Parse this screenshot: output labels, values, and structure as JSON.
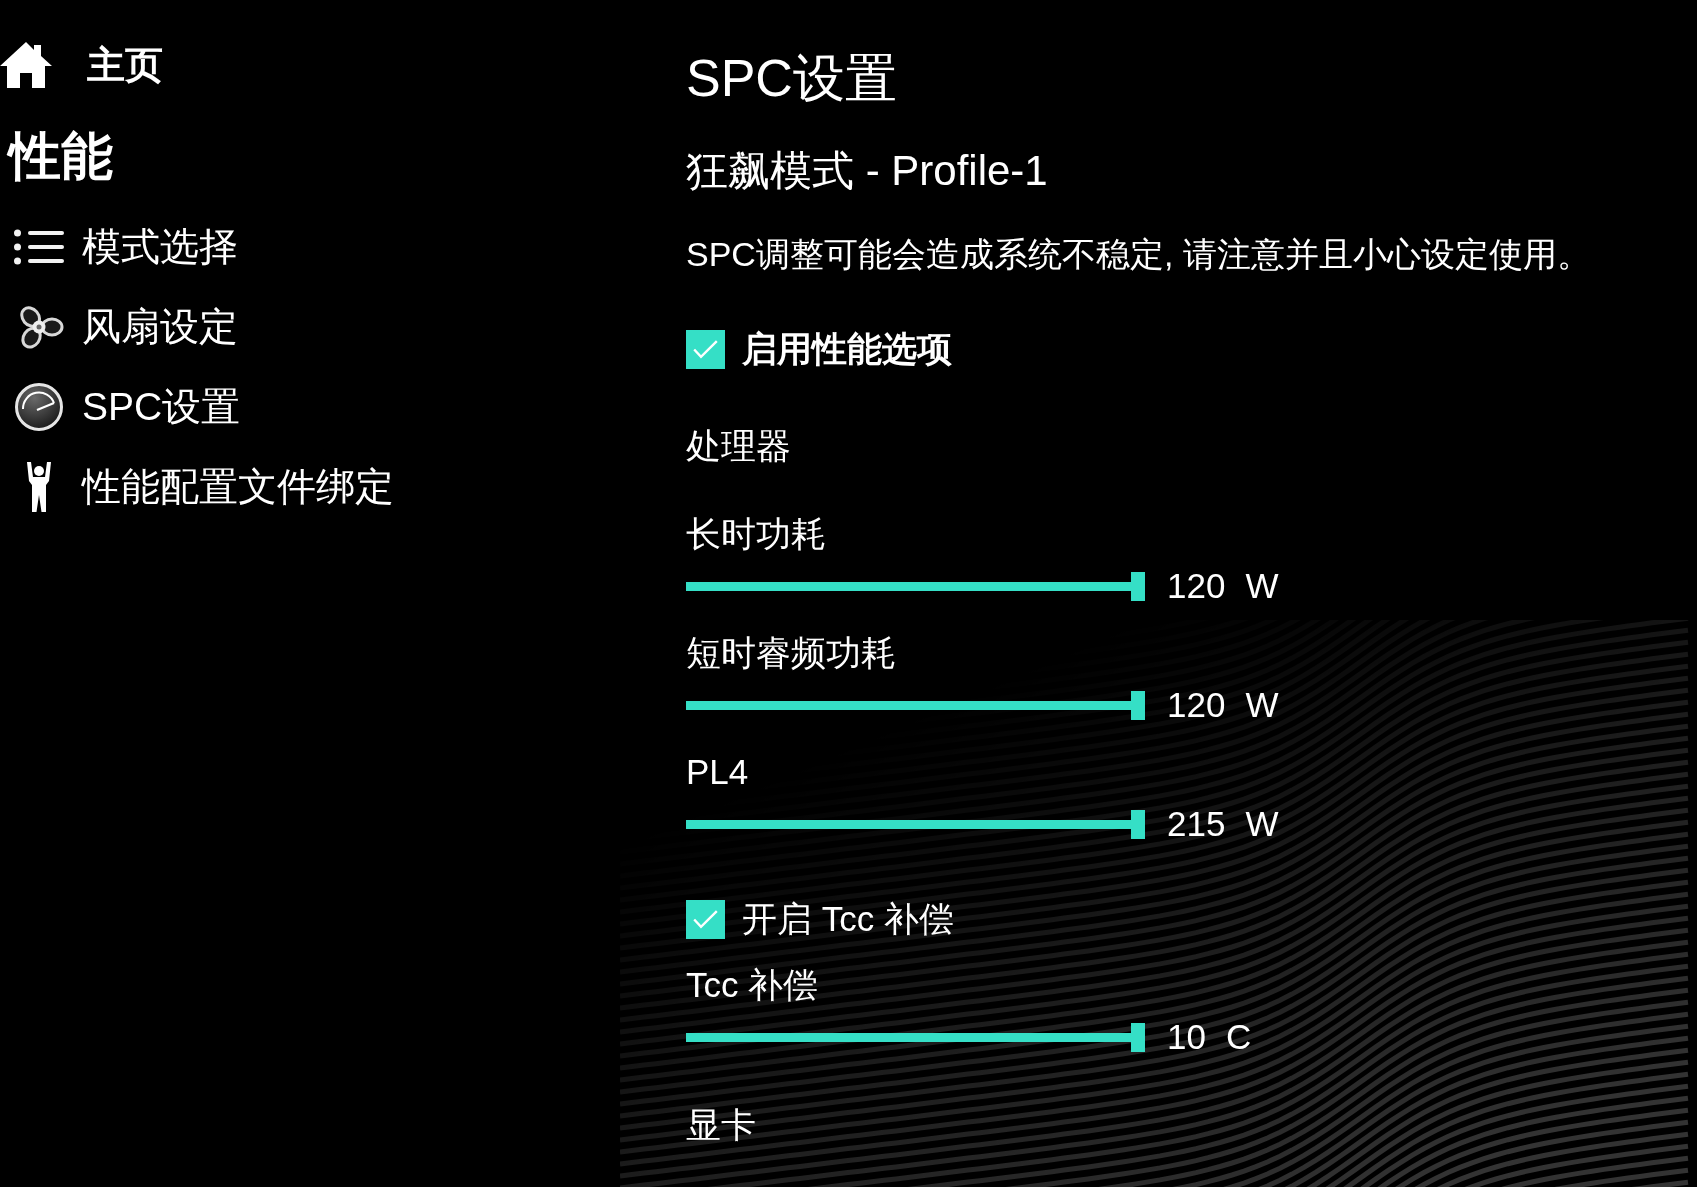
{
  "sidebar": {
    "home": {
      "label": "主页"
    },
    "section_title": "性能",
    "items": [
      {
        "label": "模式选择"
      },
      {
        "label": "风扇设定"
      },
      {
        "label": "SPC设置"
      },
      {
        "label": "性能配置文件绑定"
      }
    ]
  },
  "main": {
    "title": "SPC设置",
    "profile": "狂飙模式 - Profile-1",
    "warning": "SPC调整可能会造成系统不稳定, 请注意并且小心设定使用。",
    "enable_option": {
      "label": "启用性能选项",
      "checked": true
    },
    "sections": [
      {
        "heading": "处理器",
        "controls": [
          {
            "kind": "slider",
            "label": "长时功耗",
            "level": 1,
            "value": "120",
            "unit": "W"
          },
          {
            "kind": "slider",
            "label": "短时睿频功耗",
            "level": 1,
            "value": "120",
            "unit": "W"
          },
          {
            "kind": "slider",
            "label": "PL4",
            "level": 1,
            "value": "215",
            "unit": "W"
          },
          {
            "kind": "checkbox",
            "label": "开启 Tcc 补偿",
            "checked": true
          },
          {
            "kind": "slider",
            "label": "Tcc 补偿",
            "level": 1,
            "value": "10",
            "unit": "C"
          }
        ]
      },
      {
        "heading": "显卡"
      }
    ]
  }
}
